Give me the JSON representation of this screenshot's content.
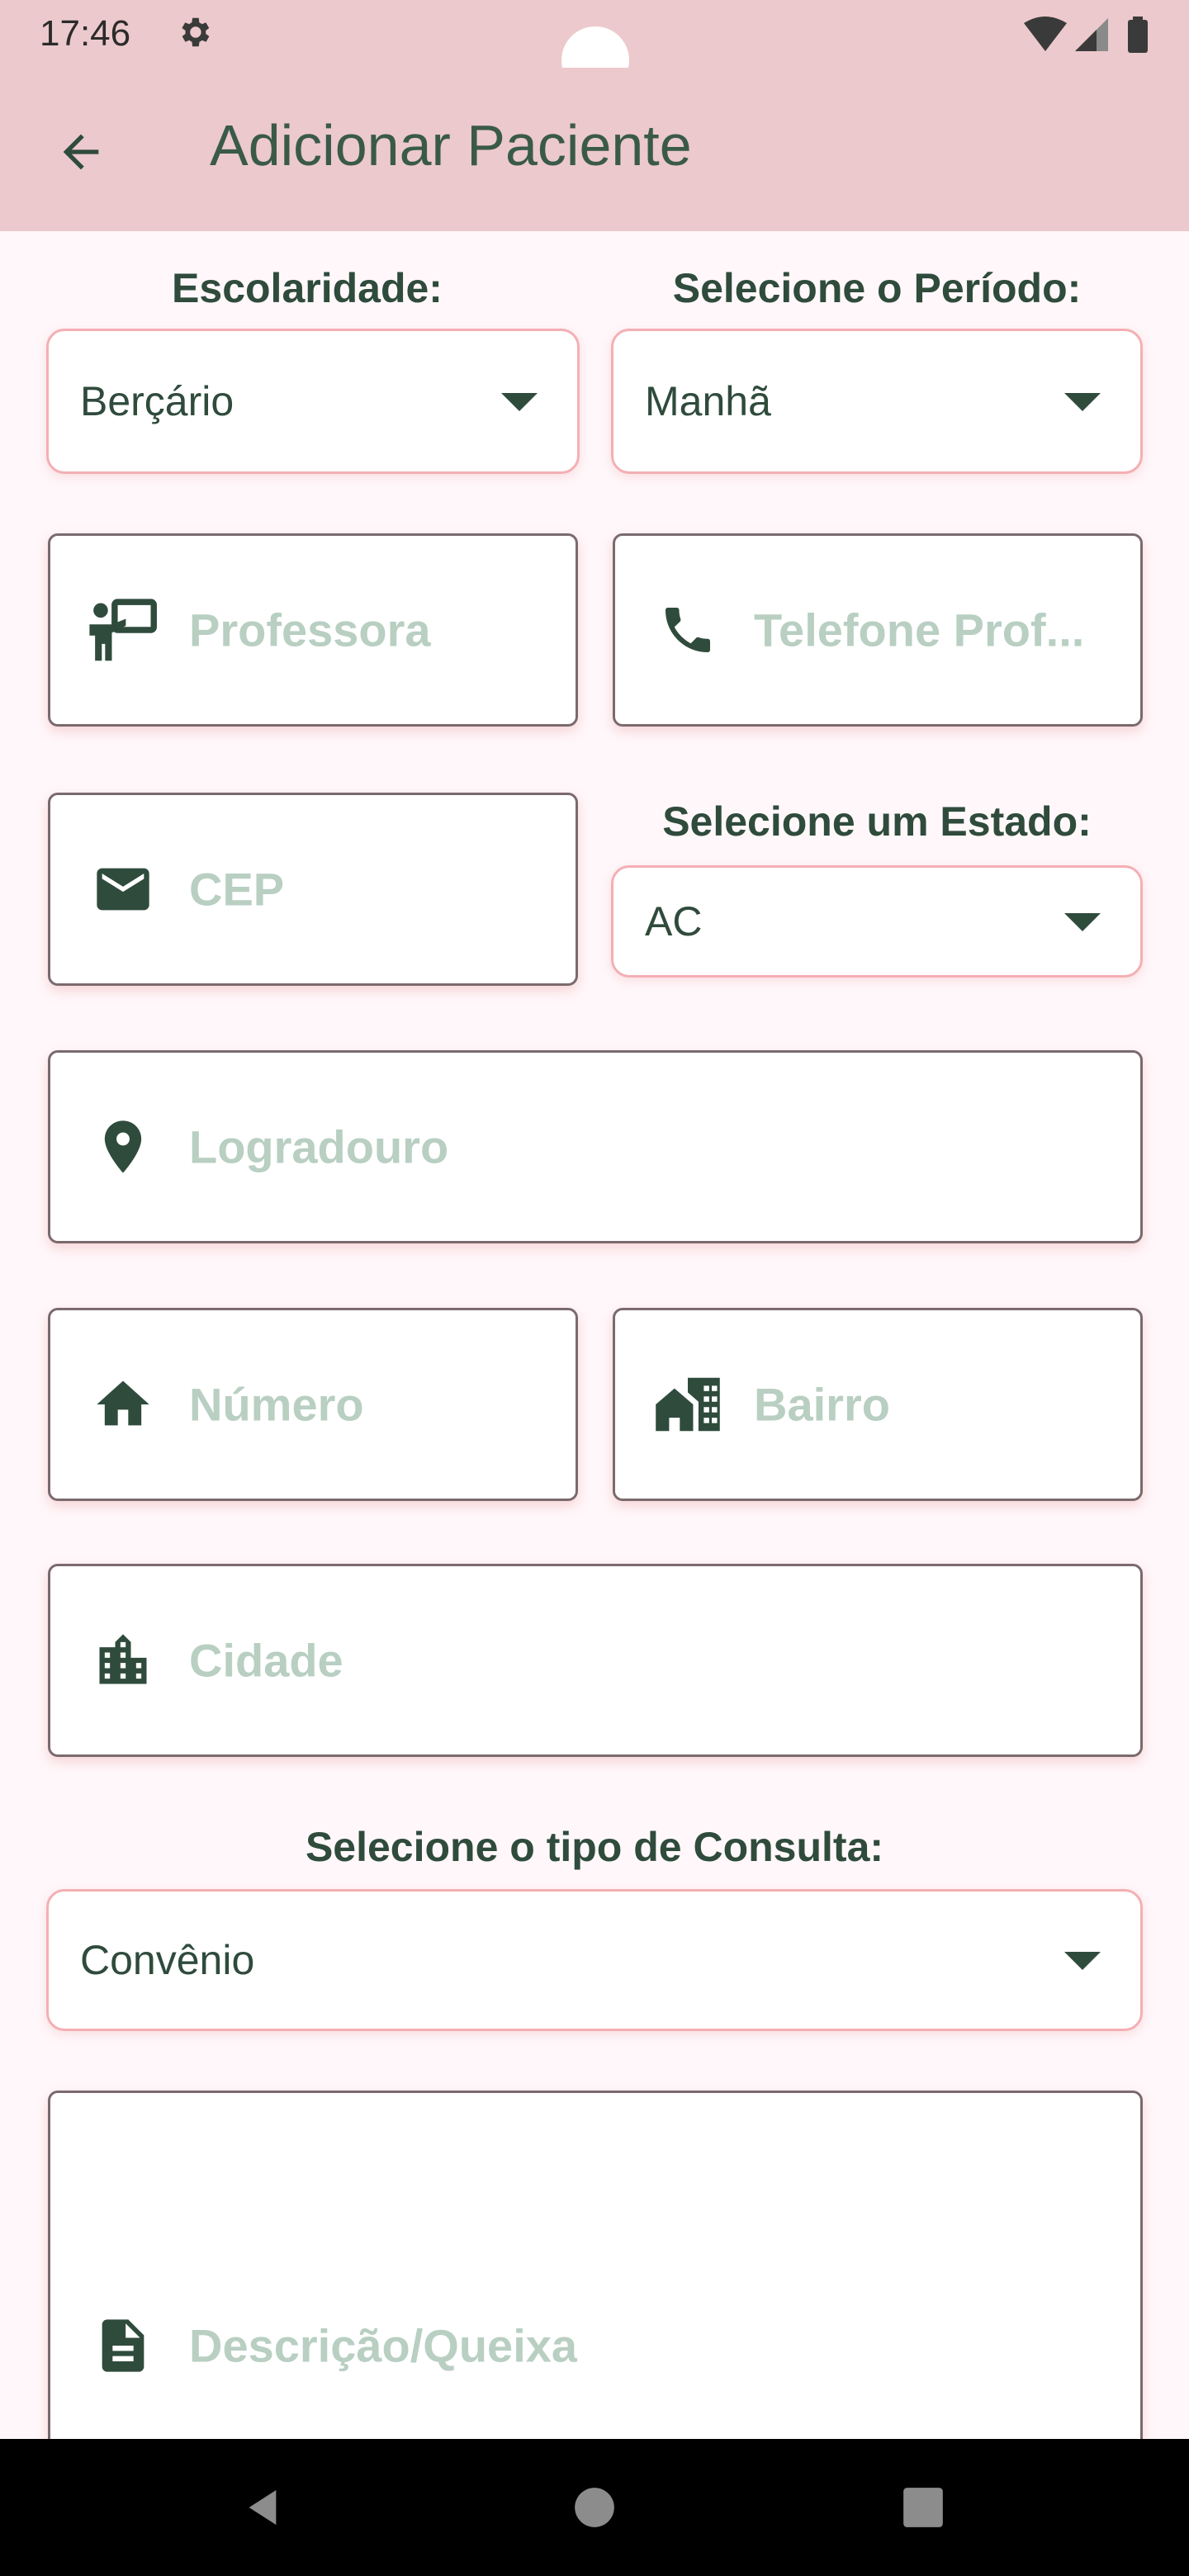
{
  "status_bar": {
    "time": "17:46"
  },
  "app_bar": {
    "title": "Adicionar Paciente"
  },
  "form": {
    "escolaridade_label": "Escolaridade:",
    "escolaridade_value": "Berçário",
    "periodo_label": "Selecione o Período:",
    "periodo_value": "Manhã",
    "professora_placeholder": "Professora",
    "telefone_placeholder": "Telefone Prof...",
    "cep_placeholder": "CEP",
    "estado_label": "Selecione um Estado:",
    "estado_value": "AC",
    "logradouro_placeholder": "Logradouro",
    "numero_placeholder": "Número",
    "bairro_placeholder": "Bairro",
    "cidade_placeholder": "Cidade",
    "consulta_label": "Selecione o tipo de Consulta:",
    "consulta_value": "Convênio",
    "descricao_placeholder": "Descrição/Queixa"
  },
  "icons": {
    "professora": "teacher-icon",
    "telefone": "phone-icon",
    "cep": "mail-icon",
    "logradouro": "location-pin-icon",
    "numero": "home-icon",
    "bairro": "house-building-icon",
    "cidade": "city-icon",
    "descricao": "document-icon"
  },
  "colors": {
    "header_bg": "#ECC9CC",
    "page_bg": "#FFF7FA",
    "primary_text": "#2F4B3C",
    "placeholder_text": "#B8CFC2",
    "dropdown_border": "#F4AFB4"
  }
}
